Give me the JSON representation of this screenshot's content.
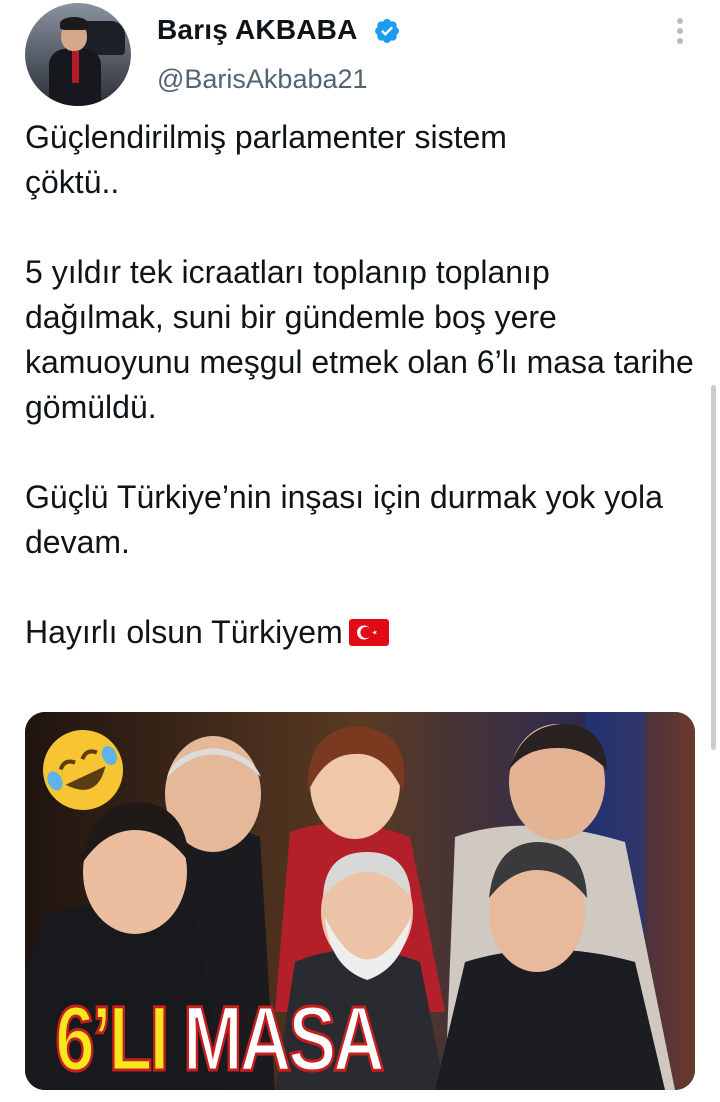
{
  "author": {
    "display_name": "Barış AKBABA",
    "handle": "@BarisAkbaba21",
    "verified": true,
    "avatar_icon": "profile-photo",
    "verified_color": "#1d9bf0"
  },
  "tweet": {
    "paragraphs": [
      "Güçlendirilmiş parlamenter sistem çöktü..",
      "5 yıldır tek icraatları toplanıp toplanıp dağılmak, suni bir gündemle boş yere kamuoyunu meşgul etmek olan 6’lı masa tarihe gömüldü.",
      "Güçlü Türkiye’nin inşası için durmak yok yola devam.",
      "Hayırlı olsun Türkiyem"
    ],
    "trailing_emoji": "turkish-flag-icon"
  },
  "media": {
    "caption_part1": "6’LI",
    "caption_part2": "MASA",
    "emoji": "rolling-on-floor-laughing-icon"
  }
}
